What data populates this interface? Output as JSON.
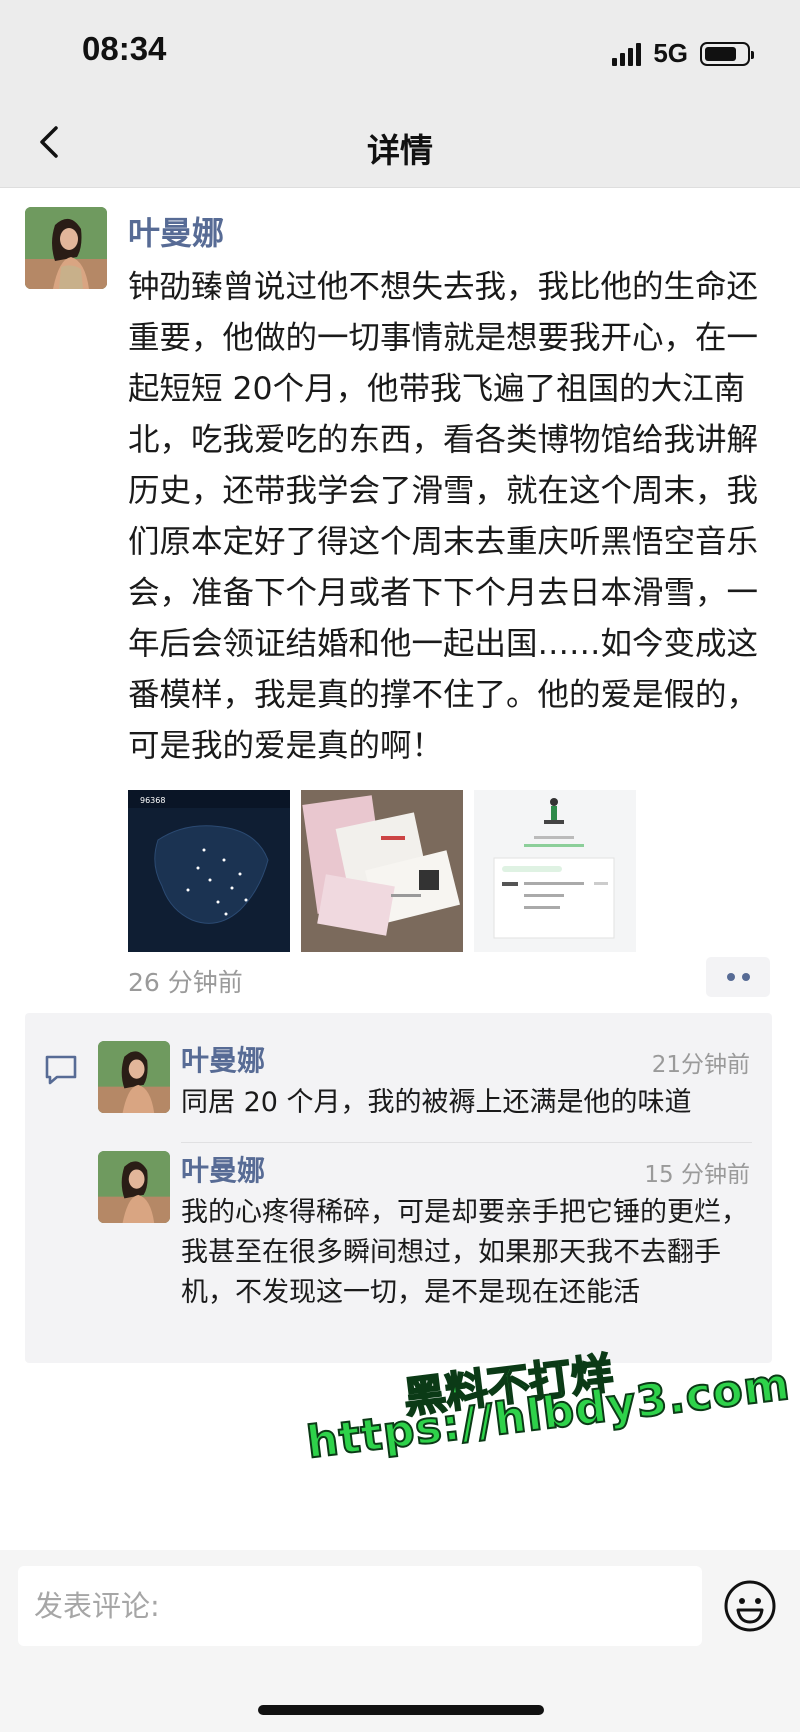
{
  "status_bar": {
    "time": "08:34",
    "network": "5G",
    "battery_level": 0.8
  },
  "nav": {
    "title": "详情",
    "back_icon": "chevron-left-icon"
  },
  "post": {
    "author": "叶曼娜",
    "text": "钟劭臻曾说过他不想失去我，我比他的生命还重要，他做的一切事情就是想要我开心，在一起短短 20个月，他带我飞遍了祖国的大江南北，吃我爱吃的东西，看各类博物馆给我讲解历史，还带我学会了滑雪，就在这个周末，我们原本定好了得这个周末去重庆听黑悟空音乐会，准备下个月或者下下个月去日本滑雪，一年后会领证结婚和他一起出国……如今变成这番模样，我是真的撑不住了。他的爱是假的，可是我的爱是真的啊！",
    "time": "26 分钟前",
    "photos": [
      {
        "name": "travel-map-photo",
        "stat_text": "96368"
      },
      {
        "name": "tickets-photo"
      },
      {
        "name": "itinerary-screenshot-photo"
      }
    ]
  },
  "comments": [
    {
      "author": "叶曼娜",
      "time": "21分钟前",
      "text": "同居 20 个月，我的被褥上还满是他的味道"
    },
    {
      "author": "叶曼娜",
      "time": "15 分钟前",
      "text": "我的心疼得稀碎，可是却要亲手把它锤的更烂，我甚至在很多瞬间想过，如果那天我不去翻手机，不发现这一切，是不是现在还能活"
    }
  ],
  "watermark": {
    "line1": "黑料不打烊",
    "line2": "https://hlbdy3.com"
  },
  "input": {
    "placeholder": "发表评论:"
  },
  "colors": {
    "name_blue": "#576b95",
    "bar_gray": "#ececec",
    "watermark_green": "#2ed24a"
  }
}
